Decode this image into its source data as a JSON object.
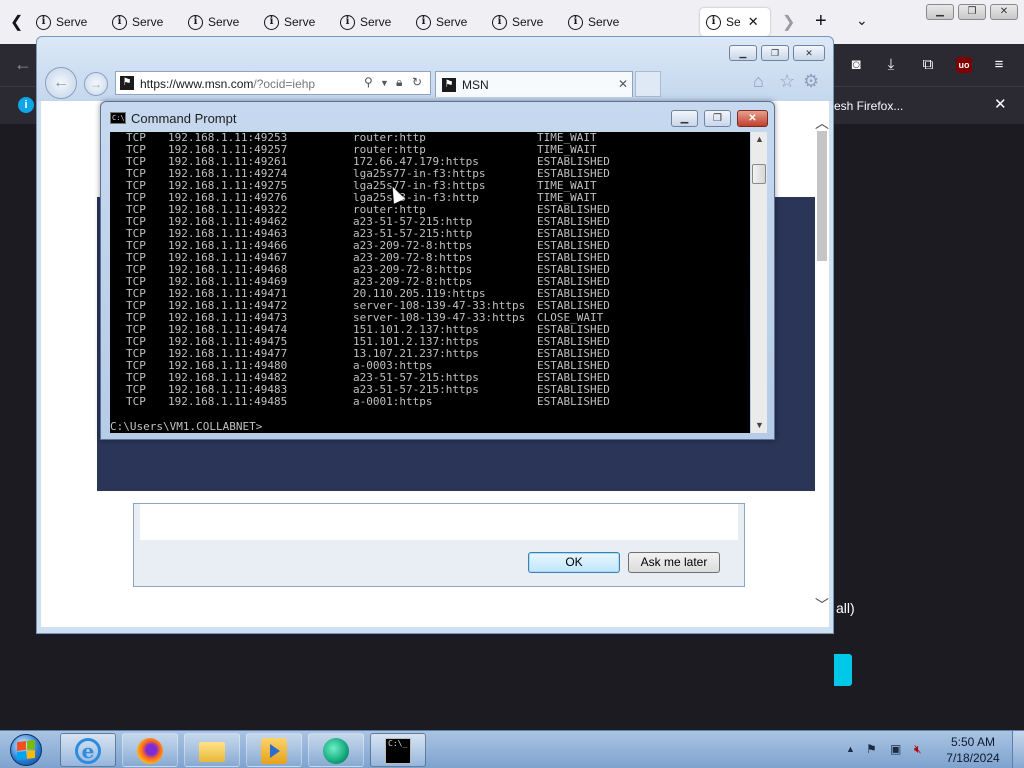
{
  "firefox": {
    "tab_label": "Serve",
    "active_tab_label": "Se",
    "tab_count": 9,
    "new_tab": "+",
    "notification_text": "esh Firefox...",
    "page_text": "all)",
    "colors": {
      "chrome": "#f0f0f4",
      "toolbar": "#2b2a33",
      "accent_button": "#00c8e8"
    }
  },
  "ie": {
    "address_url_host": "https://www.msn.com",
    "address_url_path": "/?ocid=iehp",
    "tab_title": "MSN",
    "dialog": {
      "ok_label": "OK",
      "later_label": "Ask me later"
    }
  },
  "cmd": {
    "title": "Command Prompt",
    "lines": [
      {
        "proto": "TCP",
        "local": "192.168.1.11:49253",
        "foreign": "router:http",
        "state": "TIME_WAIT"
      },
      {
        "proto": "TCP",
        "local": "192.168.1.11:49257",
        "foreign": "router:http",
        "state": "TIME_WAIT"
      },
      {
        "proto": "TCP",
        "local": "192.168.1.11:49261",
        "foreign": "172.66.47.179:https",
        "state": "ESTABLISHED"
      },
      {
        "proto": "TCP",
        "local": "192.168.1.11:49274",
        "foreign": "lga25s77-in-f3:https",
        "state": "ESTABLISHED"
      },
      {
        "proto": "TCP",
        "local": "192.168.1.11:49275",
        "foreign": "lga25s77-in-f3:https",
        "state": "TIME_WAIT"
      },
      {
        "proto": "TCP",
        "local": "192.168.1.11:49276",
        "foreign": "lga25s73-in-f3:http",
        "state": "TIME_WAIT"
      },
      {
        "proto": "TCP",
        "local": "192.168.1.11:49322",
        "foreign": "router:http",
        "state": "ESTABLISHED"
      },
      {
        "proto": "TCP",
        "local": "192.168.1.11:49462",
        "foreign": "a23-51-57-215:http",
        "state": "ESTABLISHED"
      },
      {
        "proto": "TCP",
        "local": "192.168.1.11:49463",
        "foreign": "a23-51-57-215:http",
        "state": "ESTABLISHED"
      },
      {
        "proto": "TCP",
        "local": "192.168.1.11:49466",
        "foreign": "a23-209-72-8:https",
        "state": "ESTABLISHED"
      },
      {
        "proto": "TCP",
        "local": "192.168.1.11:49467",
        "foreign": "a23-209-72-8:https",
        "state": "ESTABLISHED"
      },
      {
        "proto": "TCP",
        "local": "192.168.1.11:49468",
        "foreign": "a23-209-72-8:https",
        "state": "ESTABLISHED"
      },
      {
        "proto": "TCP",
        "local": "192.168.1.11:49469",
        "foreign": "a23-209-72-8:https",
        "state": "ESTABLISHED"
      },
      {
        "proto": "TCP",
        "local": "192.168.1.11:49471",
        "foreign": "20.110.205.119:https",
        "state": "ESTABLISHED"
      },
      {
        "proto": "TCP",
        "local": "192.168.1.11:49472",
        "foreign": "server-108-139-47-33:https",
        "state": "ESTABLISHED"
      },
      {
        "proto": "TCP",
        "local": "192.168.1.11:49473",
        "foreign": "server-108-139-47-33:https",
        "state": "CLOSE_WAIT"
      },
      {
        "proto": "TCP",
        "local": "192.168.1.11:49474",
        "foreign": "151.101.2.137:https",
        "state": "ESTABLISHED"
      },
      {
        "proto": "TCP",
        "local": "192.168.1.11:49475",
        "foreign": "151.101.2.137:https",
        "state": "ESTABLISHED"
      },
      {
        "proto": "TCP",
        "local": "192.168.1.11:49477",
        "foreign": "13.107.21.237:https",
        "state": "ESTABLISHED"
      },
      {
        "proto": "TCP",
        "local": "192.168.1.11:49480",
        "foreign": "a-0003:https",
        "state": "ESTABLISHED"
      },
      {
        "proto": "TCP",
        "local": "192.168.1.11:49482",
        "foreign": "a23-51-57-215:https",
        "state": "ESTABLISHED"
      },
      {
        "proto": "TCP",
        "local": "192.168.1.11:49483",
        "foreign": "a23-51-57-215:https",
        "state": "ESTABLISHED"
      },
      {
        "proto": "TCP",
        "local": "192.168.1.11:49485",
        "foreign": "a-0001:https",
        "state": "ESTABLISHED"
      }
    ],
    "prompt": "C:\\Users\\VM1.COLLABNET>"
  },
  "taskbar": {
    "time": "5:50 AM",
    "date": "7/18/2024",
    "cmd_icon_text": "C:\\_"
  }
}
